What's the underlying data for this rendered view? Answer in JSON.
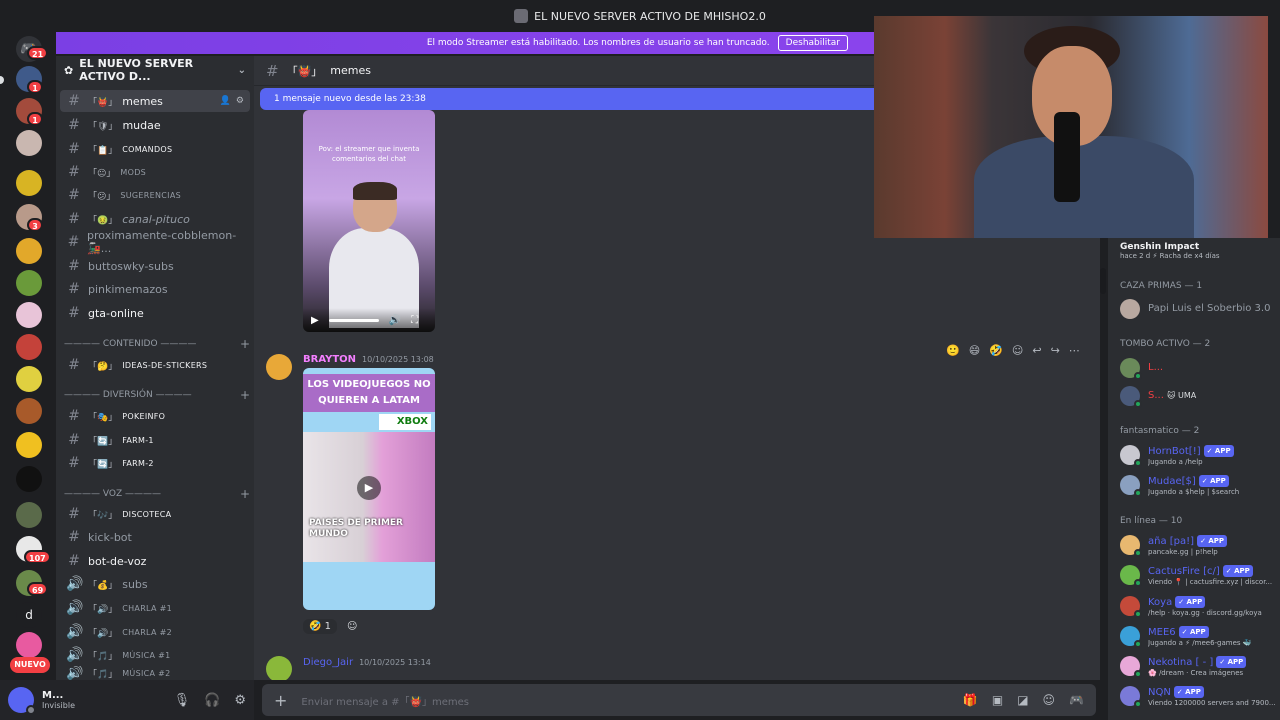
{
  "window": {
    "title": "EL NUEVO SERVER ACTIVO DE MHISHO2.0"
  },
  "banner": {
    "text": "El modo Streamer está habilitado. Los nombres de usuario se han truncado.",
    "button": "Deshabilitar"
  },
  "guilds": {
    "badges": [
      "21",
      "1",
      "1",
      "3",
      "107",
      "69"
    ],
    "new_label": "NUEVO",
    "dm_letter": "d"
  },
  "server": {
    "name": "EL NUEVO SERVER ACTIVO D..."
  },
  "channels": [
    {
      "emoji": "「👹」",
      "name": "memes",
      "active": true
    },
    {
      "emoji": "「🛡」",
      "name": "mudae"
    },
    {
      "emoji": "「📋」",
      "name": "COMANDOS",
      "smallcaps": true
    },
    {
      "emoji": "「😐」",
      "name": "MODS",
      "smallcaps": true
    },
    {
      "emoji": "「😕」",
      "name": "SUGERENCIAS",
      "smallcaps": true
    },
    {
      "emoji": "「🤢」",
      "name": "canal-pituco",
      "italic": true
    },
    {
      "name": "proximamente-cobblemon-🚂..."
    },
    {
      "name": "buttoswky-subs"
    },
    {
      "name": "pinkimemazos"
    },
    {
      "name": "gta-online",
      "bold": true
    }
  ],
  "categories": {
    "contenido": "———— CONTENIDO ————",
    "diversion": "———— DIVERSIÓN ————",
    "voz": "———— VOZ ————"
  },
  "channels2": [
    {
      "emoji": "「🤔」",
      "name": "IDEAS-DE-STICKERS"
    },
    {
      "emoji": "「🎭」",
      "name": "POKEINFO"
    },
    {
      "emoji": "「🔄」",
      "name": "FARM-1"
    },
    {
      "emoji": "「🔄」",
      "name": "FARM-2"
    },
    {
      "emoji": "「🎶」",
      "name": "DISCOTECA"
    },
    {
      "name": "kick-bot"
    },
    {
      "name": "bot-de-voz"
    },
    {
      "emoji": "「💰」",
      "name": "subs",
      "voice": true
    },
    {
      "emoji": "「🔊」",
      "name": "CHARLA #1",
      "voice": true
    },
    {
      "emoji": "「🔊」",
      "name": "CHARLA #2",
      "voice": true
    },
    {
      "emoji": "「🎵」",
      "name": "MÚSICA #1",
      "voice": true
    },
    {
      "emoji": "「🎵」",
      "name": "MÚSICA #2",
      "voice": true
    }
  ],
  "user": {
    "name": "M...",
    "status": "Invisible"
  },
  "chat": {
    "channel": "memes",
    "channel_emoji": "「👹」",
    "new_messages": "1 mensaje nuevo desde las 23:38",
    "video1_caption": "Pov: el streamer que inventa comentarios del chat",
    "msg2": {
      "author": "BRAYTON",
      "time": "10/10/2025 13:08",
      "author_color": "#f47fff"
    },
    "video2": {
      "title": "LOS VIDEOJUEGOS NO QUIEREN A LATAM",
      "xbox": "XBOX",
      "bottom": "PAISES DE PRIMER MUNDO"
    },
    "reaction": {
      "emoji": "🤣",
      "count": "1"
    },
    "msg3": {
      "author": "Diego_Jair",
      "time": "10/10/2025 13:14"
    },
    "composer_placeholder": "Enviar mensaje a #「👹」memes"
  },
  "members": {
    "game": {
      "title": "Genshin Impact",
      "sub": "hace 2 d  ⚡ Racha de x4 días"
    },
    "groups": [
      {
        "header": "CAZA PRIMAS — 1",
        "members": [
          {
            "name": "Papi Luis el Soberbio 3.0",
            "color": "#949ba4"
          }
        ]
      },
      {
        "header": "TOMBO ACTIVO — 2",
        "members": [
          {
            "name": "L...",
            "color": "#f23f43"
          },
          {
            "name": "S...",
            "color": "#f23f43",
            "tag": "🐱 UMA"
          }
        ]
      },
      {
        "header": "fantasmatico — 2",
        "members": [
          {
            "name": "HornBot[!]",
            "color": "#5865f2",
            "app": "✓ APP",
            "status": "Jugando a /help"
          },
          {
            "name": "Mudae[$]",
            "color": "#5865f2",
            "app": "✓ APP",
            "status": "Jugando a $help | $search"
          }
        ]
      },
      {
        "header": "En línea — 10",
        "members": [
          {
            "name": "aña [pa!]",
            "color": "#5865f2",
            "app": "✓ APP",
            "status": "pancake.gg | p!help"
          },
          {
            "name": "CactusFire [c/]",
            "color": "#5865f2",
            "app": "✓ APP",
            "status": "Viendo 📍 | cactusfire.xyz | discor..."
          },
          {
            "name": "Koya",
            "color": "#5865f2",
            "app": "✓ APP",
            "status": "/help · koya.gg · discord.gg/koya"
          },
          {
            "name": "MEE6",
            "color": "#5865f2",
            "app": "✓ APP",
            "status": "Jugando a ⚡ /mee6-games 🐳"
          },
          {
            "name": "Nekotina [ - ]",
            "color": "#5865f2",
            "app": "✓ APP",
            "status": "🌸 /dream · Crea imágenes"
          },
          {
            "name": "NQN",
            "color": "#5865f2",
            "app": "✓ APP",
            "status": "Viendo 1200000 servers and 7900..."
          }
        ]
      }
    ]
  },
  "colors": {
    "accent": "#5865f2",
    "streamer_banner": "#8a44ec",
    "online": "#23a55a",
    "danger": "#f23f43"
  }
}
